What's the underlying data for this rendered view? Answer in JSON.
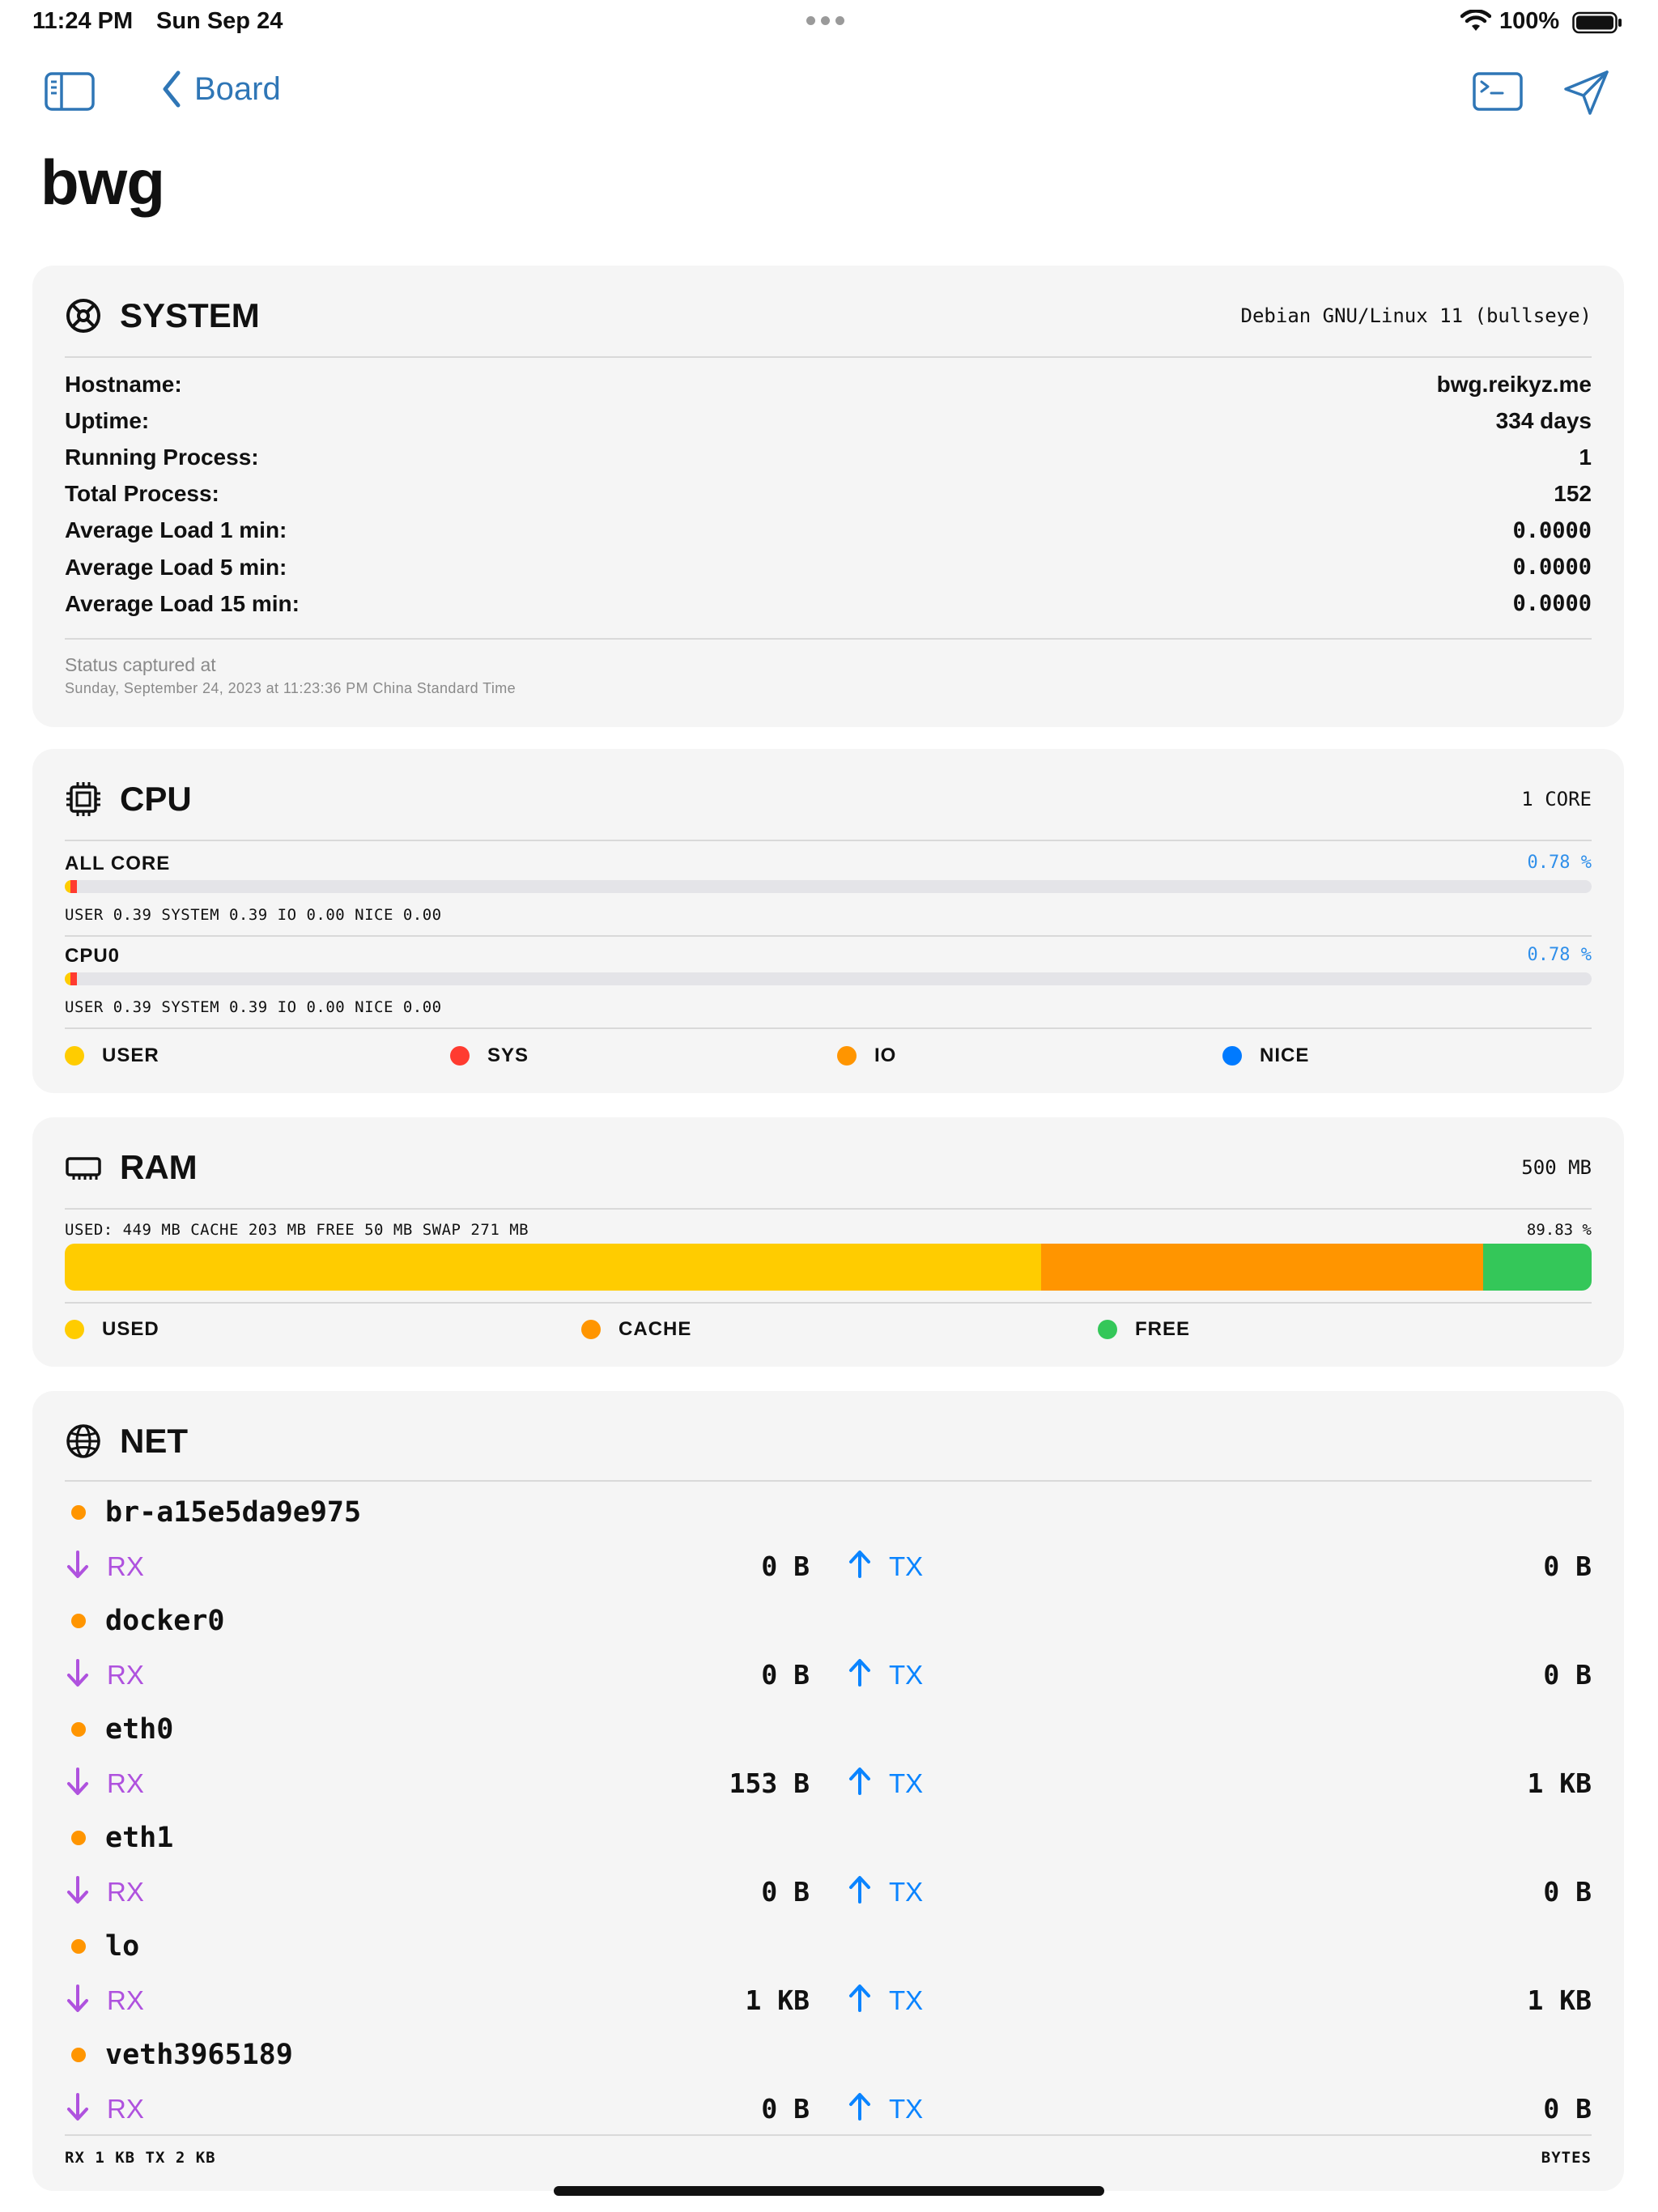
{
  "status_bar": {
    "time": "11:24 PM",
    "date": "Sun Sep 24",
    "battery": "100%"
  },
  "nav": {
    "back_label": "Board"
  },
  "page": {
    "title": "bwg"
  },
  "colors": {
    "accent": "#2f76b6",
    "user": "#ffcc00",
    "sys": "#ff3b30",
    "io": "#ff9500",
    "nice": "#007aff",
    "free": "#34c759",
    "rx": "#af52de",
    "tx": "#0a84ff"
  },
  "system": {
    "title": "SYSTEM",
    "os": "Debian GNU/Linux 11 (bullseye)",
    "rows": [
      {
        "label": "Hostname:",
        "value": "bwg.reikyz.me"
      },
      {
        "label": "Uptime:",
        "value": "334 days"
      },
      {
        "label": "Running Process:",
        "value": "1"
      },
      {
        "label": "Total Process:",
        "value": "152"
      },
      {
        "label": "Average Load 1 min:",
        "value": "0.0000"
      },
      {
        "label": "Average Load 5 min:",
        "value": "0.0000"
      },
      {
        "label": "Average Load 15 min:",
        "value": "0.0000"
      }
    ],
    "captured_label": "Status captured at",
    "captured_time": "Sunday, September 24, 2023 at 11:23:36 PM China Standard Time"
  },
  "cpu": {
    "title": "CPU",
    "cores": "1 CORE",
    "items": [
      {
        "label": "ALL CORE",
        "percent": "0.78 %",
        "detail": "USER 0.39 SYSTEM 0.39 IO 0.00 NICE 0.00",
        "user": 0.39,
        "system": 0.39,
        "io": 0.0,
        "nice": 0.0
      },
      {
        "label": "CPU0",
        "percent": "0.78 %",
        "detail": "USER 0.39 SYSTEM 0.39 IO 0.00 NICE 0.00",
        "user": 0.39,
        "system": 0.39,
        "io": 0.0,
        "nice": 0.0
      }
    ],
    "legend": [
      "USER",
      "SYS",
      "IO",
      "NICE"
    ]
  },
  "ram": {
    "title": "RAM",
    "total": "500 MB",
    "detail": "USED: 449 MB CACHE 203 MB FREE 50 MB SWAP 271 MB",
    "percent": "89.83 %",
    "segments": {
      "used": 449,
      "cache": 203,
      "free": 50
    },
    "legend": [
      "USED",
      "CACHE",
      "FREE"
    ]
  },
  "net": {
    "title": "NET",
    "rx_label": "RX",
    "tx_label": "TX",
    "interfaces": [
      {
        "name": "br-a15e5da9e975",
        "rx": "0 B",
        "tx": "0 B"
      },
      {
        "name": "docker0",
        "rx": "0 B",
        "tx": "0 B"
      },
      {
        "name": "eth0",
        "rx": "153 B",
        "tx": "1 KB"
      },
      {
        "name": "eth1",
        "rx": "0 B",
        "tx": "0 B"
      },
      {
        "name": "lo",
        "rx": "1 KB",
        "tx": "1 KB"
      },
      {
        "name": "veth3965189",
        "rx": "0 B",
        "tx": "0 B"
      }
    ],
    "footer_left": "RX  1 KB  TX  2 KB",
    "footer_right": "BYTES"
  }
}
